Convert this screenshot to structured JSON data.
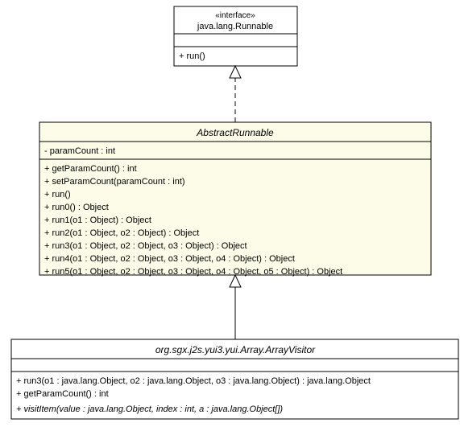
{
  "interface": {
    "stereotype": "«interface»",
    "name": "java.lang.Runnable",
    "methods": [
      "+ run()"
    ]
  },
  "abstract": {
    "name": "AbstractRunnable",
    "attributes": [
      "- paramCount : int"
    ],
    "methods": [
      "+ getParamCount() : int",
      "+ setParamCount(paramCount : int)",
      "+ run()",
      "+ run0() : Object",
      "+ run1(o1 : Object) : Object",
      "+ run2(o1 : Object, o2 : Object) : Object",
      "+ run3(o1 : Object, o2 : Object, o3 : Object) : Object",
      "+ run4(o1 : Object, o2 : Object, o3 : Object, o4 : Object) : Object",
      "+ run5(o1 : Object, o2 : Object, o3 : Object, o4 : Object, o5 : Object) : Object"
    ]
  },
  "concrete": {
    "name": "org.sgx.j2s.yui3.yui.Array.ArrayVisitor",
    "methods": [
      "+ run3(o1 : java.lang.Object, o2 : java.lang.Object, o3 : java.lang.Object) : java.lang.Object",
      "+ getParamCount() : int",
      "+ visitItem(value : java.lang.Object, index : int, a : java.lang.Object[])"
    ]
  }
}
